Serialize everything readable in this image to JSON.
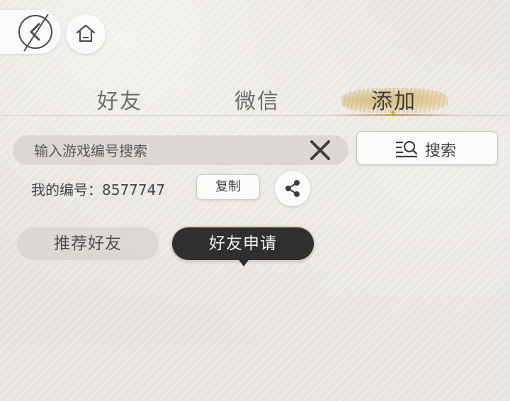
{
  "nav": {
    "back_icon": "back-arrow-icon",
    "home_icon": "home-icon"
  },
  "tabs": [
    {
      "label": "好友",
      "active": false
    },
    {
      "label": "微信",
      "active": false
    },
    {
      "label": "添加",
      "active": true
    }
  ],
  "search": {
    "placeholder": "输入游戏编号搜索",
    "value": "",
    "clear_icon": "close-icon",
    "button_label": "搜索",
    "button_icon": "search-list-icon"
  },
  "my_id": {
    "text": "我的编号：8577747",
    "copy_label": "复制",
    "share_icon": "share-icon"
  },
  "sub_tabs": [
    {
      "label": "推荐好友",
      "active": false
    },
    {
      "label": "好友申请",
      "active": true
    }
  ],
  "colors": {
    "accent_gold": "#c8a45c",
    "active_pill": "#2f2f30",
    "text_dark": "#3e3e3e"
  }
}
